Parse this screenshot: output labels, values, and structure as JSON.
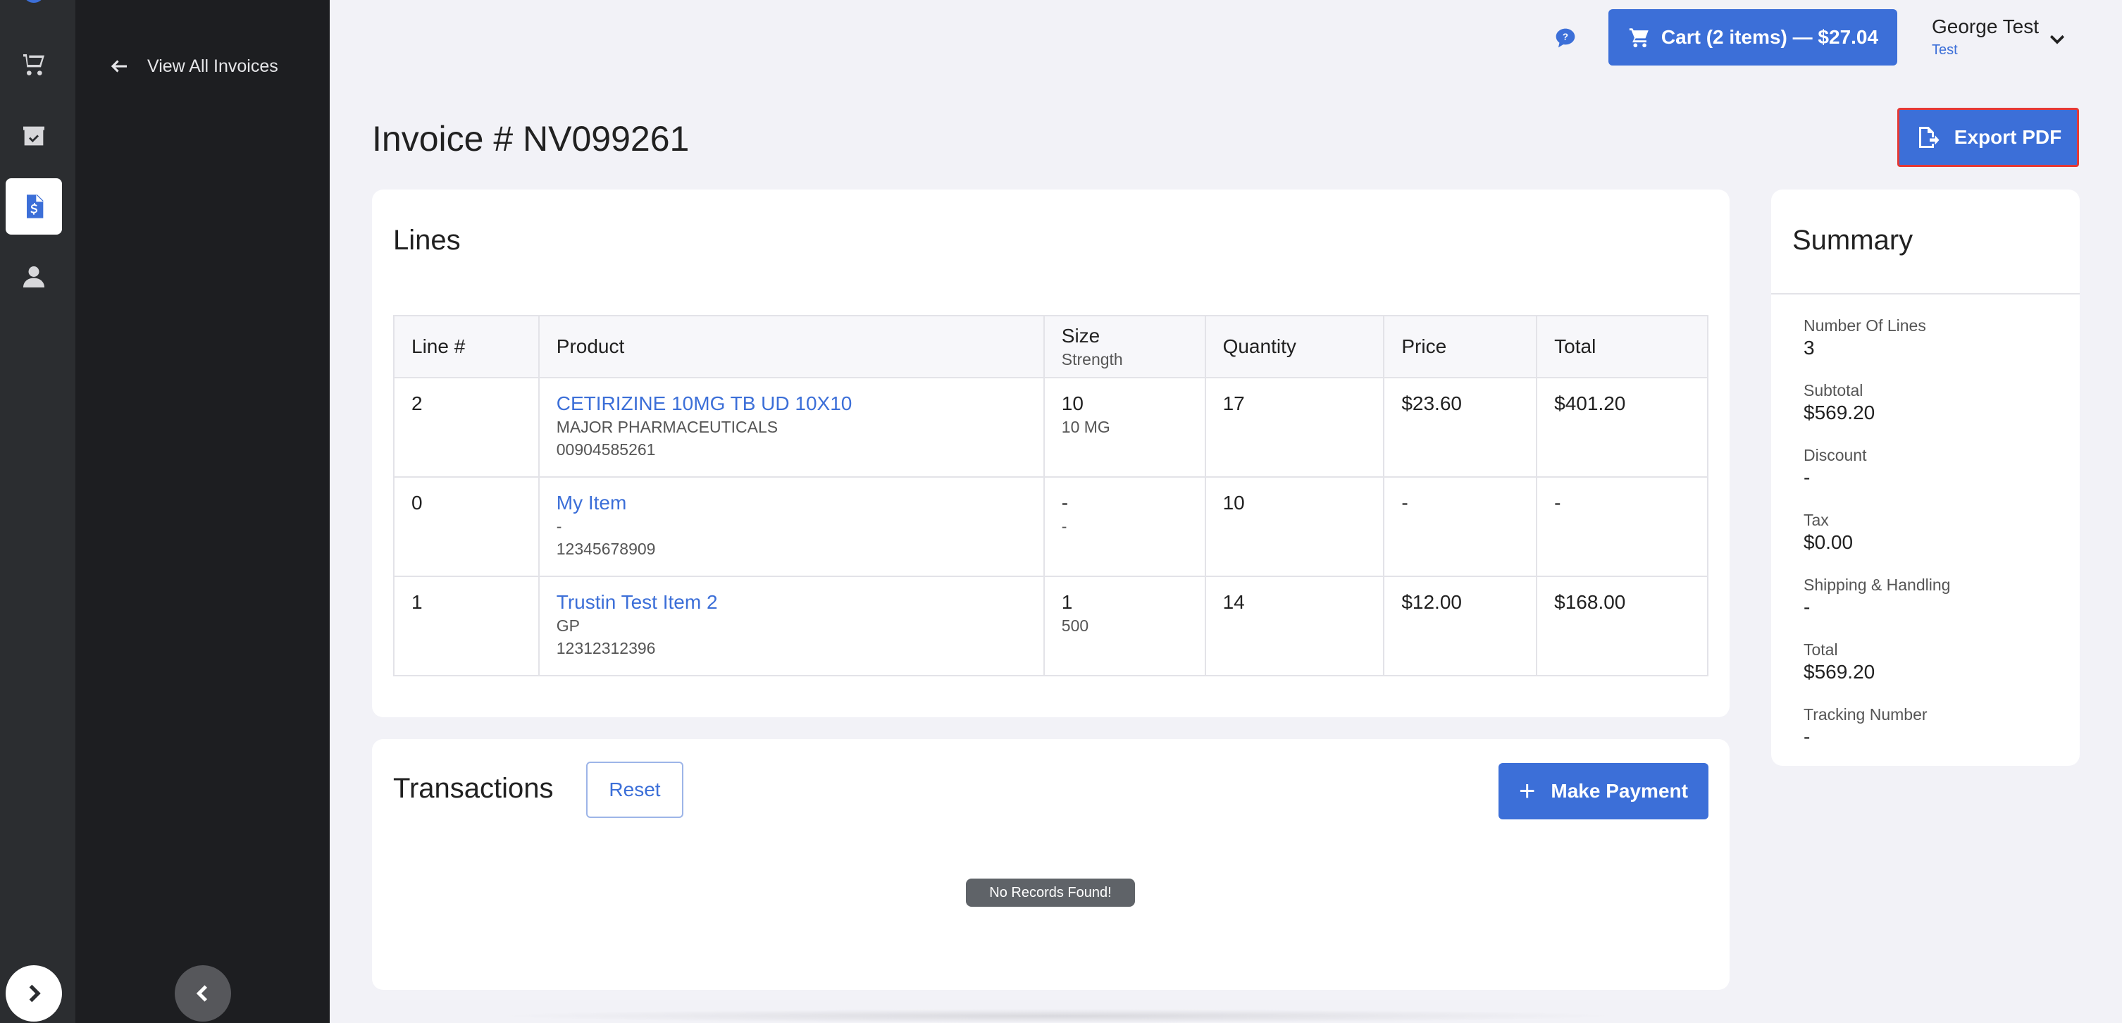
{
  "nav": {
    "rail_icons": [
      "cart-icon",
      "box-icon",
      "invoice-icon",
      "user-icon"
    ],
    "active": "invoice-icon",
    "back_label": "View All Invoices"
  },
  "header": {
    "cart_label": "Cart (2 items) — $27.04",
    "user_name": "George Test",
    "user_role": "Test"
  },
  "page": {
    "title": "Invoice # NV099261",
    "export_label": "Export PDF"
  },
  "lines": {
    "title": "Lines",
    "columns": {
      "line": "Line #",
      "product": "Product",
      "size": "Size",
      "size_sub": "Strength",
      "quantity": "Quantity",
      "price": "Price",
      "total": "Total"
    },
    "rows": [
      {
        "line": "2",
        "product": "CETIRIZINE 10MG TB UD 10X10",
        "manufacturer": "MAJOR PHARMACEUTICALS",
        "ndc": "00904585261",
        "size": "10",
        "strength": "10 MG",
        "quantity": "17",
        "price": "$23.60",
        "total": "$401.20"
      },
      {
        "line": "0",
        "product": "My Item",
        "manufacturer": "-",
        "ndc": "12345678909",
        "size": "-",
        "strength": "-",
        "quantity": "10",
        "price": "-",
        "total": "-"
      },
      {
        "line": "1",
        "product": "Trustin Test Item 2",
        "manufacturer": "GP",
        "ndc": "12312312396",
        "size": "1",
        "strength": "500",
        "quantity": "14",
        "price": "$12.00",
        "total": "$168.00"
      }
    ]
  },
  "transactions": {
    "title": "Transactions",
    "reset_label": "Reset",
    "pay_label": "Make Payment",
    "plus": "+",
    "empty_label": "No Records Found!"
  },
  "summary": {
    "title": "Summary",
    "items": [
      {
        "label": "Number Of Lines",
        "value": "3"
      },
      {
        "label": "Subtotal",
        "value": "$569.20"
      },
      {
        "label": "Discount",
        "value": "-"
      },
      {
        "label": "Tax",
        "value": "$0.00"
      },
      {
        "label": "Shipping & Handling",
        "value": "-"
      },
      {
        "label": "Total",
        "value": "$569.20"
      },
      {
        "label": "Tracking Number",
        "value": "-"
      }
    ]
  },
  "colors": {
    "accent": "#3c6fd8",
    "rail": "#2b2d30",
    "panel": "#1d1e21",
    "highlight": "#e53935"
  }
}
